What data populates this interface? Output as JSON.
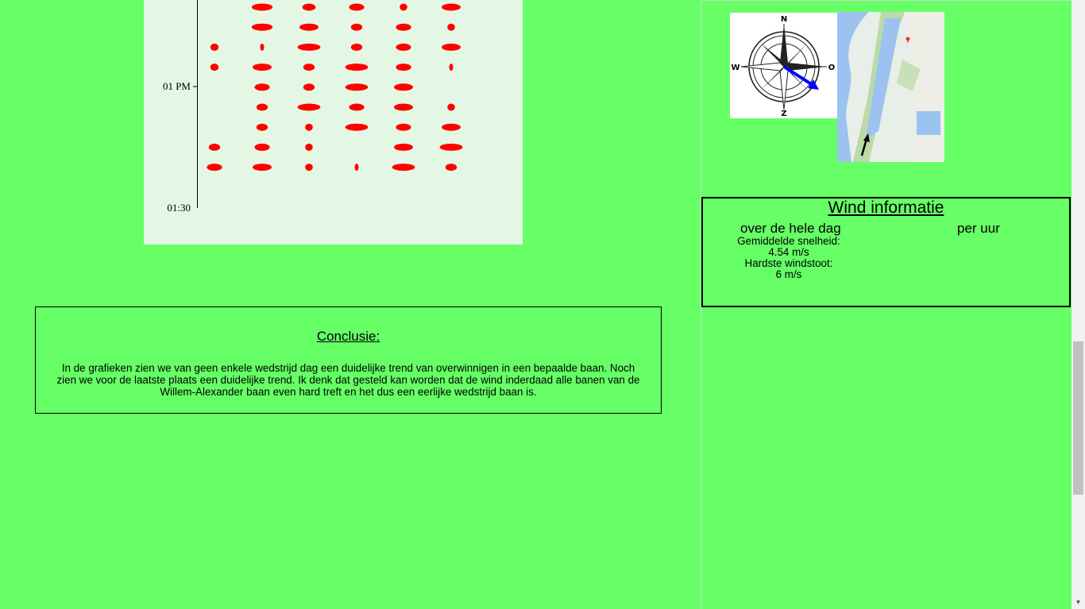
{
  "chart_data": {
    "type": "scatter",
    "y_tick_labels": [
      "01 PM",
      "01:30"
    ],
    "marker_color": "#ff0000",
    "rows": [
      [
        null,
        0.55,
        0.35,
        0.4,
        0.2,
        0.5
      ],
      [
        null,
        0.55,
        0.5,
        0.3,
        0.4,
        0.2
      ],
      [
        0.22,
        0.08,
        0.6,
        0.3,
        0.4,
        0.5
      ],
      [
        0.22,
        0.5,
        0.3,
        0.6,
        0.4,
        0.06
      ],
      [
        null,
        0.4,
        0.3,
        0.6,
        0.5,
        null
      ],
      [
        null,
        0.3,
        0.6,
        0.4,
        0.5,
        0.2
      ],
      [
        null,
        0.3,
        0.2,
        0.6,
        0.4,
        0.5
      ],
      [
        0.3,
        0.4,
        0.2,
        null,
        0.5,
        0.6
      ],
      [
        0.4,
        0.5,
        0.2,
        0.08,
        0.6,
        0.3
      ]
    ]
  },
  "conclusion": {
    "title": "Conclusie:",
    "text": "In de grafieken zien we van geen enkele wedstrijd dag een duidelijke trend van overwinnigen in een bepaalde baan. Noch zien we voor de laatste plaats een duidelijke trend. Ik denk dat gesteld kan worden dat de wind inderdaad alle banen van de Willem-Alexander baan even hard treft en het dus een eerlijke wedstrijd baan is."
  },
  "compass": {
    "north": "N",
    "south": "Z",
    "west": "W",
    "east": "O",
    "arrow_color": "#0000ff"
  },
  "map": {
    "icon": "map-pin-icon",
    "arrow_color": "#000000"
  },
  "wind_info": {
    "title": "Wind informatie",
    "day_heading": "over de hele dag",
    "hour_heading": "per uur",
    "avg_speed_label": "Gemiddelde snelheid:",
    "avg_speed_value": "4.54 m/s",
    "gust_label": "Hardste windstoot:",
    "gust_value": "6 m/s"
  },
  "colors": {
    "background": "#66ff66",
    "chart_background": "#e4f7e4"
  }
}
